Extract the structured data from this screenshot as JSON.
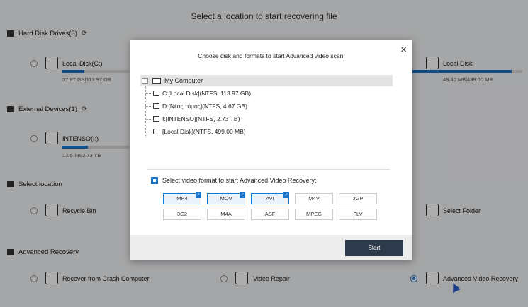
{
  "background": {
    "title": "Select a location to start recovering file",
    "sections": {
      "hdd": "Hard Disk Drives(3)",
      "external": "External Devices(1)",
      "location": "Select location",
      "advanced": "Advanced Recovery"
    },
    "drives": [
      {
        "label": "Local Disk(C:)",
        "size": "37.97 GB|113.97 GB",
        "used_fraction": 0.33
      },
      {
        "label": "Local Disk",
        "size": "48.40 MB|499.00 MB",
        "used_fraction": 0.9
      }
    ],
    "external": [
      {
        "label": "INTENSO(I:)",
        "size": "1.05 TB|2.73 TB",
        "used_fraction": 0.38
      }
    ],
    "locations": {
      "recycle_bin": "Recycle Bin",
      "select_folder": "Select Folder"
    },
    "advanced": {
      "crash": "Recover from Crash Computer",
      "video_repair": "Video Repair",
      "advanced_video": "Advanced Video Recovery"
    }
  },
  "modal": {
    "title": "Choose disk and formats to start Advanced video scan:",
    "close_icon": "×",
    "tree": {
      "root": "My Computer",
      "expander": "−",
      "items": [
        "C:[Local Disk](NTFS, 113.97 GB)",
        "D:[Νέος τόμος](NTFS, 4.67 GB)",
        "I:[INTENSO](NTFS, 2.73 TB)",
        "[Local Disk](NTFS, 499.00 MB)"
      ]
    },
    "format_header": "Select video format to start Advanced Video Recovery:",
    "formats": [
      {
        "label": "MP4",
        "selected": true
      },
      {
        "label": "MOV",
        "selected": true
      },
      {
        "label": "AVI",
        "selected": true
      },
      {
        "label": "M4V",
        "selected": false
      },
      {
        "label": "3GP",
        "selected": false
      },
      {
        "label": "3G2",
        "selected": false
      },
      {
        "label": "M4A",
        "selected": false
      },
      {
        "label": "ASF",
        "selected": false
      },
      {
        "label": "MPEG",
        "selected": false
      },
      {
        "label": "FLV",
        "selected": false
      }
    ],
    "start_label": "Start"
  },
  "colors": {
    "accent": "#1a74c9",
    "button": "#2d3a4c"
  }
}
